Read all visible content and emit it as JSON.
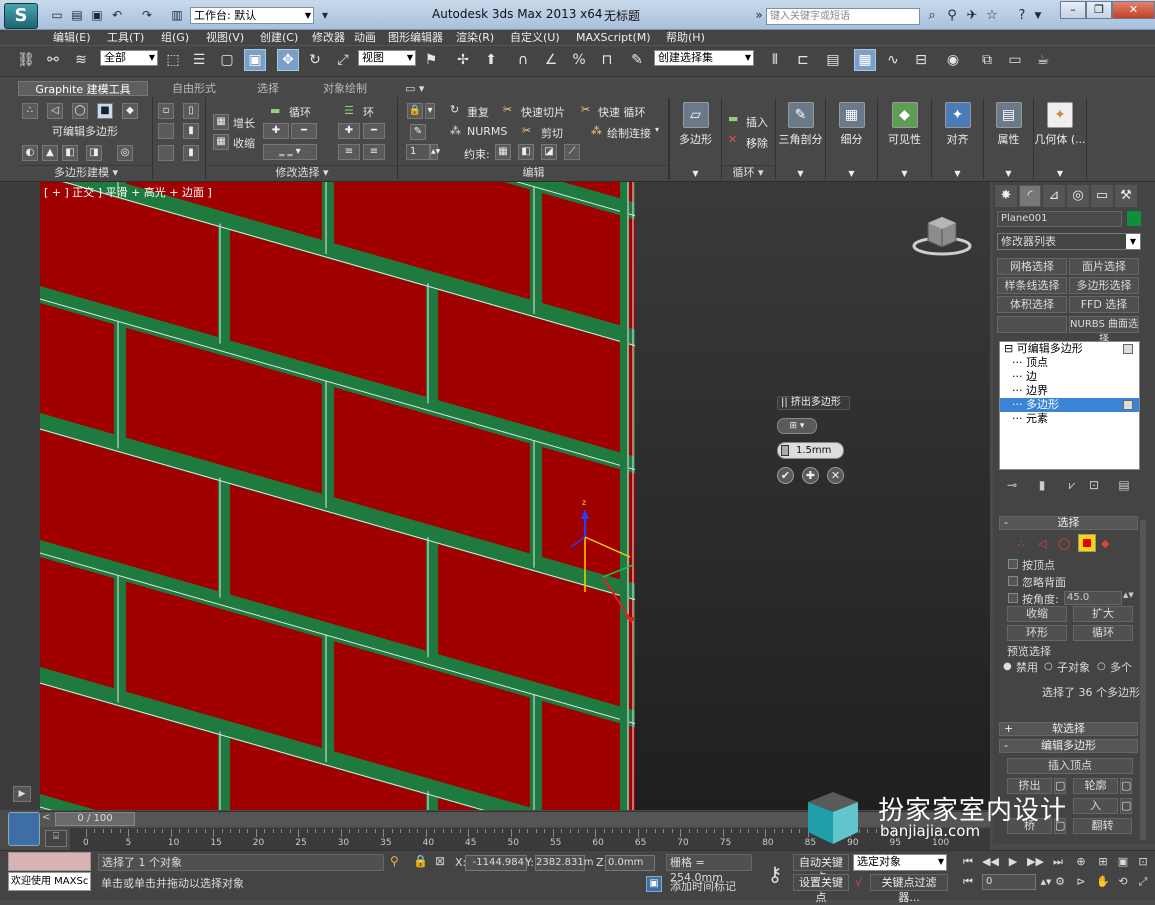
{
  "titlebar": {
    "workspace": "工作台: 默认",
    "app_title": "Autodesk 3ds Max  2013 x64",
    "doc_title": "无标题",
    "search_placeholder": "键入关键字或短语",
    "help_label": "?"
  },
  "menubar": [
    "编辑(E)",
    "工具(T)",
    "组(G)",
    "视图(V)",
    "创建(C)",
    "修改器",
    "动画",
    "图形编辑器",
    "渲染(R)",
    "自定义(U)",
    "MAXScript(M)",
    "帮助(H)"
  ],
  "main_toolbar": {
    "selection_filter": "全部",
    "ref_coord": "视图",
    "named_selection": "创建选择集"
  },
  "ribbon": {
    "tabs": [
      "Graphite 建模工具",
      "自由形式",
      "选择",
      "对象绘制"
    ],
    "groups": {
      "poly_modeling": {
        "title": "多边形建模",
        "label": "可编辑多边形"
      },
      "modify_selection": {
        "title": "修改选择",
        "grow": "增长",
        "shrink": "收缩",
        "loop": "循环",
        "ring": "环"
      },
      "edit": {
        "title": "编辑",
        "repeat": "重复",
        "quickslice": "快速切片",
        "quickloop": "快速 循环",
        "nurms": "NURMS",
        "cut": "剪切",
        "paintconnect": "绘制连接",
        "constrain": "约束:",
        "spinner_value": "1"
      },
      "loops": {
        "title": "循环",
        "insert": "插入",
        "remove": "移除"
      }
    },
    "big_buttons": [
      "多边形",
      "三角剖分",
      "细分",
      "可见性",
      "对齐",
      "属性",
      "几何体 (..."
    ]
  },
  "viewport": {
    "label": "[ + ] 正交 ] 平滑 + 高光 + 边面 ]",
    "axis_z": "z"
  },
  "caddy": {
    "title": "|| 挤出多边形",
    "type_button": "⊞ ▾",
    "amount": "1.5mm",
    "ok": "✔",
    "apply": "✚",
    "cancel": "✕"
  },
  "command_panel": {
    "object_name": "Plane001",
    "modifier_list": "修改器列表",
    "modifier_sets": [
      "网格选择",
      "面片选择",
      "样条线选择",
      "多边形选择",
      "体积选择",
      "FFD 选择",
      "",
      "NURBS 曲面选择"
    ],
    "stack": [
      {
        "label": "可编辑多边形",
        "indent": 0,
        "selected": false
      },
      {
        "label": "顶点",
        "indent": 1,
        "selected": false
      },
      {
        "label": "边",
        "indent": 1,
        "selected": false
      },
      {
        "label": "边界",
        "indent": 1,
        "selected": false
      },
      {
        "label": "多边形",
        "indent": 1,
        "selected": true
      },
      {
        "label": "元素",
        "indent": 1,
        "selected": false
      }
    ],
    "selection_rollout": {
      "title": "选择",
      "by_vertex": "按顶点",
      "ignore_backfacing": "忽略背面",
      "by_angle": "按角度:",
      "angle_value": "45.0",
      "shrink": "收缩",
      "grow": "扩大",
      "ring": "环形",
      "loop": "循环",
      "preview_title": "预览选择",
      "preview_off": "禁用",
      "preview_subobj": "子对象",
      "preview_multi": "多个",
      "status": "选择了 36 个多边形"
    },
    "soft_selection": "软选择",
    "edit_polygons": {
      "title": "编辑多边形",
      "insert_vertex": "插入顶点",
      "extrude": "挤出",
      "outline": "轮廓",
      "inset": "入",
      "bridge": "桥",
      "flip": "翻转"
    }
  },
  "time": {
    "frame": "0 / 100",
    "ticks": [
      "0",
      "5",
      "10",
      "15",
      "20",
      "25",
      "30",
      "35",
      "40",
      "45",
      "50",
      "55",
      "60",
      "65",
      "70",
      "75",
      "80",
      "85",
      "90",
      "95",
      "100"
    ]
  },
  "status": {
    "welcome": "欢迎使用 MAXSc",
    "selected": "选择了 1 个对象",
    "prompt": "单击或单击并拖动以选择对象",
    "x_label": "X:",
    "x": "-1144.984",
    "y_label": "Y:",
    "y": "2382.831m",
    "z_label": "Z:",
    "z": "0.0mm",
    "grid": "栅格 = 254.0mm",
    "add_time_tag": "添加时间标记",
    "auto_key": "自动关键点",
    "set_key": "设置关键点",
    "key_mode": "选定对象",
    "key_filters": "关键点过滤器...",
    "frame_field": "0"
  },
  "watermark": {
    "text": "扮家家室内设计",
    "url": "banjiajia.com"
  },
  "colors": {
    "brick": "#a00000",
    "mortar": "#1e7a3e",
    "accent": "#3a84d6"
  }
}
